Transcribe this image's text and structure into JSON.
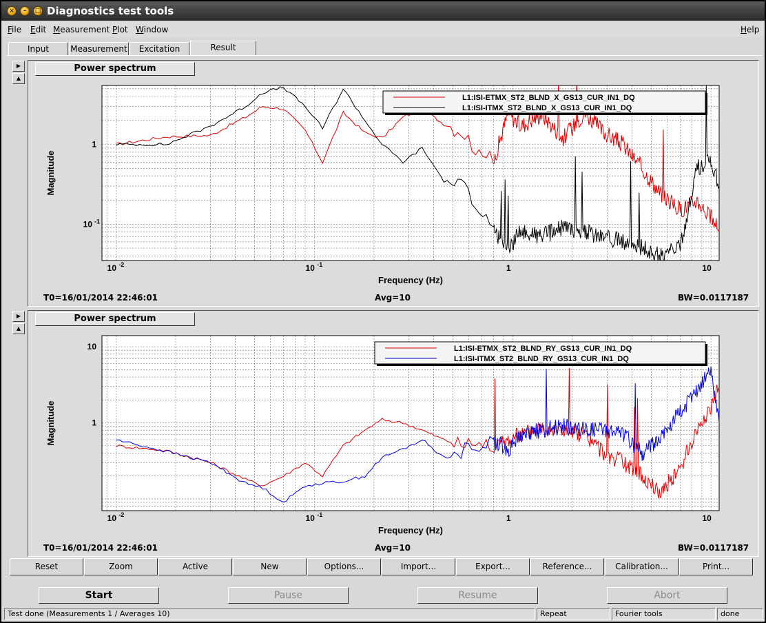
{
  "window": {
    "title": "Diagnostics test tools"
  },
  "menu": {
    "file": "File",
    "edit": "Edit",
    "measurement": "Measurement",
    "plot": "Plot",
    "window": "Window",
    "help": "Help"
  },
  "tabs": [
    "Input",
    "Measurement",
    "Excitation",
    "Result"
  ],
  "active_tab": "Result",
  "panes": [
    {
      "title": "Power spectrum",
      "t0": "T0=16/01/2014 22:46:01",
      "avg": "Avg=10",
      "bw": "BW=0.0117187",
      "xlabel": "Frequency (Hz)",
      "ylabel": "Magnitude",
      "xticks": [
        "10",
        "10",
        "1",
        "10"
      ],
      "xtick_exp": [
        "-2",
        "-1",
        "",
        ""
      ],
      "yticks": [
        "1",
        "10"
      ],
      "ytick_exp": [
        "",
        "-1"
      ],
      "legend": [
        "L1:ISI-ETMX_ST2_BLND_X_GS13_CUR_IN1_DQ",
        "L1:ISI-ITMX_ST2_BLND_X_GS13_CUR_IN1_DQ"
      ]
    },
    {
      "title": "Power spectrum",
      "t0": "T0=16/01/2014 22:46:01",
      "avg": "Avg=10",
      "bw": "BW=0.0117187",
      "xlabel": "Frequency (Hz)",
      "ylabel": "Magnitude",
      "xticks": [
        "10",
        "10",
        "1",
        "10"
      ],
      "xtick_exp": [
        "-2",
        "-1",
        "",
        ""
      ],
      "yticks": [
        "10",
        "1"
      ],
      "ytick_exp": [
        "",
        ""
      ],
      "legend": [
        "L1:ISI-ETMX_ST2_BLND_RY_GS13_CUR_IN1_DQ",
        "L1:ISI-ITMX_ST2_BLND_RY_GS13_CUR_IN1_DQ"
      ]
    }
  ],
  "buttons": [
    "Reset",
    "Zoom",
    "Active",
    "New",
    "Options...",
    "Import...",
    "Export...",
    "Reference...",
    "Calibration...",
    "Print..."
  ],
  "controls": {
    "start": "Start",
    "pause": "Pause",
    "resume": "Resume",
    "abort": "Abort"
  },
  "status": {
    "message": "Test done (Measurements 1 / Averages 10)",
    "repeat": "Repeat",
    "tools": "Fourier tools",
    "state": "done"
  },
  "colors": {
    "series_a_top": "#e00000",
    "series_b_top": "#000000",
    "series_a_bottom": "#e00000",
    "series_b_bottom": "#0000e0"
  },
  "chart_data": [
    {
      "type": "line",
      "title": "Power spectrum",
      "xlabel": "Frequency (Hz)",
      "ylabel": "Magnitude",
      "xscale": "log",
      "yscale": "log",
      "xlim": [
        0.0085,
        11.0
      ],
      "ylim": [
        0.035,
        5.5
      ],
      "grid": true,
      "legend": "top-right",
      "series": [
        {
          "name": "L1:ISI-ETMX_ST2_BLND_X_GS13_CUR_IN1_DQ",
          "x": [
            0.01,
            0.018,
            0.03,
            0.045,
            0.055,
            0.07,
            0.09,
            0.11,
            0.14,
            0.18,
            0.22,
            0.28,
            0.35,
            0.45,
            0.55,
            0.65,
            0.8,
            0.95,
            1.1,
            1.4,
            1.8,
            2.3,
            2.9,
            3.6,
            4.5,
            5.5,
            7,
            8.5,
            10,
            11
          ],
          "y": [
            1.0,
            1.25,
            1.3,
            2.2,
            3.0,
            2.8,
            1.5,
            0.6,
            2.5,
            1.4,
            1.2,
            2.2,
            2.8,
            1.8,
            1.5,
            0.9,
            0.6,
            2.5,
            1.7,
            2.4,
            1.2,
            2.5,
            1.4,
            1.0,
            0.5,
            0.25,
            0.15,
            0.2,
            0.12,
            0.08
          ]
        },
        {
          "name": "L1:ISI-ITMX_ST2_BLND_X_GS13_CUR_IN1_DQ",
          "x": [
            0.01,
            0.018,
            0.03,
            0.045,
            0.055,
            0.07,
            0.09,
            0.11,
            0.14,
            0.18,
            0.22,
            0.28,
            0.35,
            0.45,
            0.55,
            0.65,
            0.8,
            0.95,
            1.1,
            1.4,
            1.8,
            2.3,
            2.9,
            3.6,
            4.5,
            5.5,
            7,
            8.5,
            10,
            11
          ],
          "y": [
            1.0,
            1.0,
            1.7,
            3.0,
            4.5,
            5.2,
            3.0,
            1.6,
            5.0,
            2.0,
            1.0,
            0.6,
            0.9,
            0.35,
            0.3,
            0.2,
            0.08,
            0.05,
            0.08,
            0.07,
            0.09,
            0.08,
            0.07,
            0.06,
            0.05,
            0.04,
            0.05,
            0.5,
            0.6,
            0.3
          ]
        }
      ]
    },
    {
      "type": "line",
      "title": "Power spectrum",
      "xlabel": "Frequency (Hz)",
      "ylabel": "Magnitude",
      "xscale": "log",
      "yscale": "log",
      "xlim": [
        0.0085,
        11.0
      ],
      "ylim": [
        0.07,
        14
      ],
      "grid": true,
      "legend": "top-right",
      "series": [
        {
          "name": "L1:ISI-ETMX_ST2_BLND_RY_GS13_CUR_IN1_DQ",
          "x": [
            0.01,
            0.018,
            0.03,
            0.045,
            0.055,
            0.07,
            0.09,
            0.11,
            0.14,
            0.18,
            0.22,
            0.28,
            0.35,
            0.45,
            0.55,
            0.65,
            0.8,
            0.95,
            1.1,
            1.4,
            1.8,
            2.3,
            2.9,
            3.6,
            4.5,
            5.5,
            7,
            8.5,
            10,
            11
          ],
          "y": [
            0.5,
            0.43,
            0.3,
            0.18,
            0.15,
            0.2,
            0.3,
            0.2,
            0.5,
            0.8,
            1.1,
            1.0,
            0.8,
            0.6,
            0.5,
            0.55,
            0.5,
            0.6,
            0.7,
            0.9,
            0.8,
            0.7,
            0.4,
            0.3,
            0.2,
            0.12,
            0.25,
            0.8,
            1.6,
            3.0
          ]
        },
        {
          "name": "L1:ISI-ITMX_ST2_BLND_RY_GS13_CUR_IN1_DQ",
          "x": [
            0.01,
            0.018,
            0.03,
            0.045,
            0.055,
            0.07,
            0.09,
            0.11,
            0.14,
            0.18,
            0.22,
            0.28,
            0.35,
            0.45,
            0.55,
            0.65,
            0.8,
            0.95,
            1.1,
            1.4,
            1.8,
            2.3,
            2.9,
            3.6,
            4.5,
            5.5,
            7,
            8.5,
            10,
            11
          ],
          "y": [
            0.6,
            0.42,
            0.3,
            0.16,
            0.14,
            0.09,
            0.15,
            0.16,
            0.17,
            0.2,
            0.35,
            0.45,
            0.6,
            0.35,
            0.4,
            0.5,
            0.6,
            0.45,
            0.7,
            0.8,
            0.9,
            0.8,
            0.8,
            0.7,
            0.4,
            0.6,
            1.4,
            2.5,
            5.0,
            1.0
          ]
        }
      ]
    }
  ]
}
